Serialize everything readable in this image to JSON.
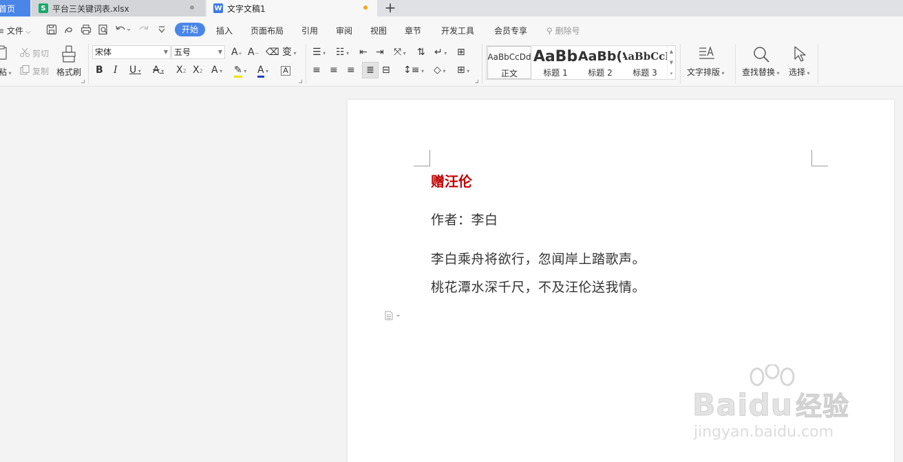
{
  "tabs": {
    "home": "首页",
    "xlsx": "平台三关键词表.xlsx",
    "doc": "文字文稿1",
    "xlsx_icon": "S",
    "doc_icon": "W",
    "add": "+"
  },
  "menu": {
    "file": "文件",
    "start": "开始",
    "insert": "插入",
    "layout": "页面布局",
    "reference": "引用",
    "review": "审阅",
    "view": "视图",
    "chapter": "章节",
    "devtools": "开发工具",
    "member": "会员专享",
    "search": "删除号"
  },
  "ribbon": {
    "paste": "粘",
    "cut": "剪切",
    "copy": "复制",
    "format_painter": "格式刷",
    "font_name": "宋体",
    "font_size": "五号",
    "styles": [
      {
        "preview": "AaBbCcDd",
        "name": "正文"
      },
      {
        "preview": "AaBb",
        "name": "标题 1"
      },
      {
        "preview": "AaBb(",
        "name": "标题 2"
      },
      {
        "preview": "AaBbCcI",
        "name": "标题 3"
      }
    ],
    "text_layout": "文字排版",
    "find_replace": "查找替换",
    "select": "选择"
  },
  "document": {
    "title": "赠汪伦",
    "author": "作者：李白",
    "lines": [
      "李白乘舟将欲行，忽闻岸上踏歌声。",
      "桃花潭水深千尺，不及汪伦送我情。"
    ]
  },
  "watermark": {
    "main": "Bai",
    "main2": "du",
    "main3": "经验",
    "sub": "jingyan.baidu.com"
  },
  "colors": {
    "accent": "#4a86e8",
    "title_red": "#c00000",
    "modified_dot": "#f5a623"
  }
}
